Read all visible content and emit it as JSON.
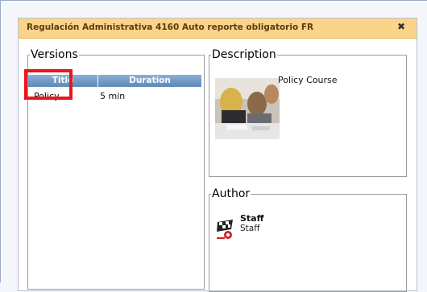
{
  "dialog": {
    "title": "Regulación Administrativa 4160 Auto reporte obligatorio FR",
    "close_symbol": "✖"
  },
  "versions": {
    "legend": "Versions",
    "columns": [
      "Title",
      "Duration"
    ],
    "rows": [
      {
        "title": "Policy",
        "duration": "5 min"
      }
    ]
  },
  "description": {
    "legend": "Description",
    "text": "Policy Course",
    "image_icon": "meeting-photo"
  },
  "author": {
    "legend": "Author",
    "name": "Staff",
    "role": "Staff",
    "logo_icon": "checkered-flag-logo"
  },
  "colors": {
    "titlebar": "#fbd48a",
    "header": "#5d88b8",
    "highlight": "#e8161f"
  }
}
